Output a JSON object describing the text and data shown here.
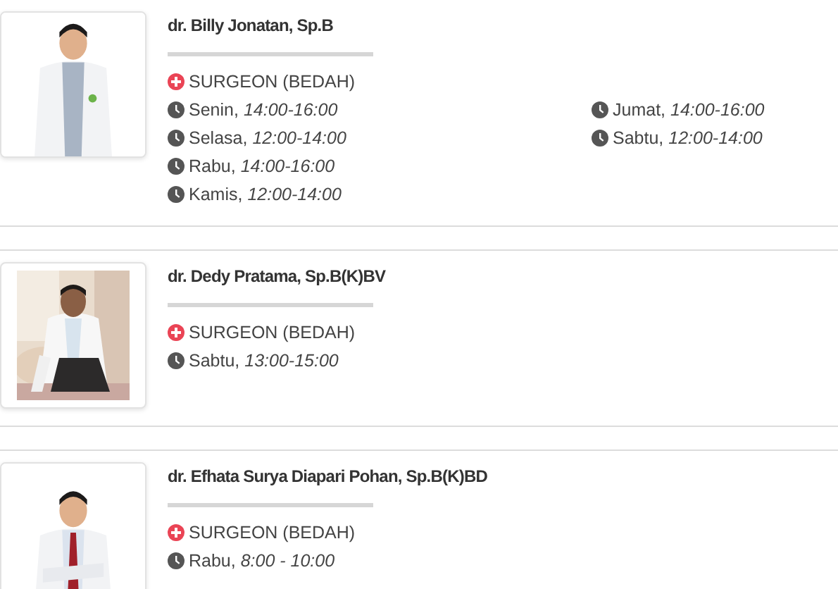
{
  "doctors": [
    {
      "name": "dr. Billy Jonatan, Sp.B",
      "specialty": "SURGEON (BEDAH)",
      "schedule": [
        {
          "day": "Senin,",
          "time": "14:00-16:00"
        },
        {
          "day": "Selasa,",
          "time": "12:00-14:00"
        },
        {
          "day": "Rabu,",
          "time": "14:00-16:00"
        },
        {
          "day": "Kamis,",
          "time": "12:00-14:00"
        },
        {
          "day": "Jumat,",
          "time": "14:00-16:00"
        },
        {
          "day": "Sabtu,",
          "time": "12:00-14:00"
        }
      ]
    },
    {
      "name": "dr. Dedy Pratama, Sp.B(K)BV",
      "specialty": "SURGEON (BEDAH)",
      "schedule": [
        {
          "day": "Sabtu,",
          "time": "13:00-15:00"
        }
      ]
    },
    {
      "name": "dr. Efhata Surya Diapari Pohan, Sp.B(K)BD",
      "specialty": "SURGEON (BEDAH)",
      "schedule": [
        {
          "day": "Rabu,",
          "time": "8:00 - 10:00"
        }
      ]
    }
  ]
}
